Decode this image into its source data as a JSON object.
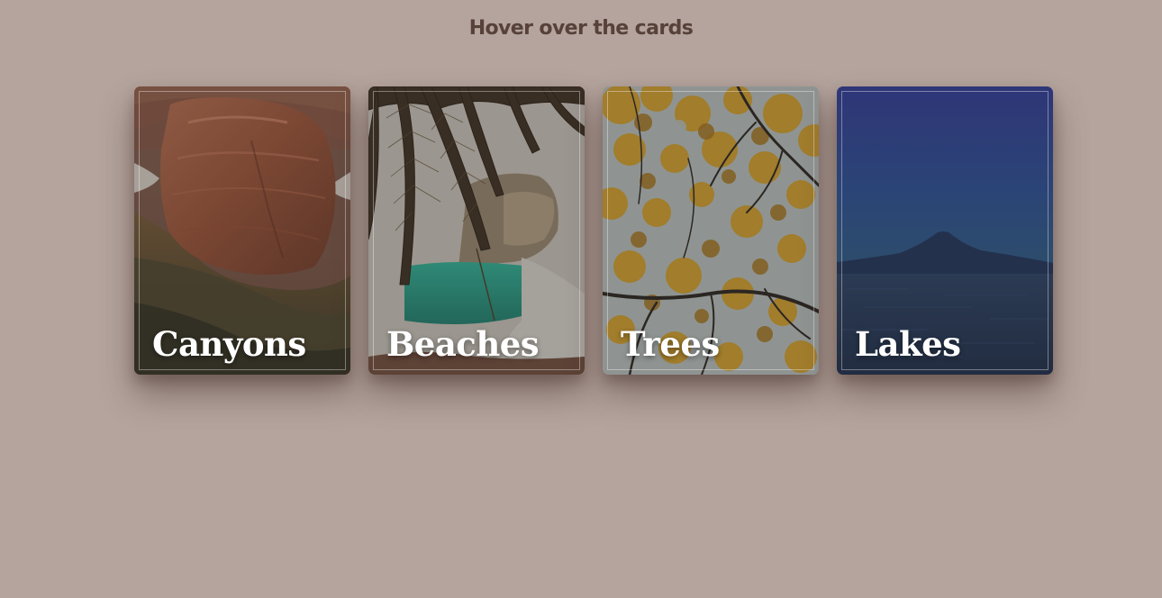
{
  "header": {
    "title": "Hover over the cards"
  },
  "cards": [
    {
      "label": "Canyons",
      "image": "canyon-image"
    },
    {
      "label": "Beaches",
      "image": "beach-palm-image"
    },
    {
      "label": "Trees",
      "image": "autumn-tree-image"
    },
    {
      "label": "Lakes",
      "image": "lake-mountain-image"
    }
  ],
  "colors": {
    "background": "#b4a49d",
    "title": "#574139",
    "label": "#ffffff"
  }
}
